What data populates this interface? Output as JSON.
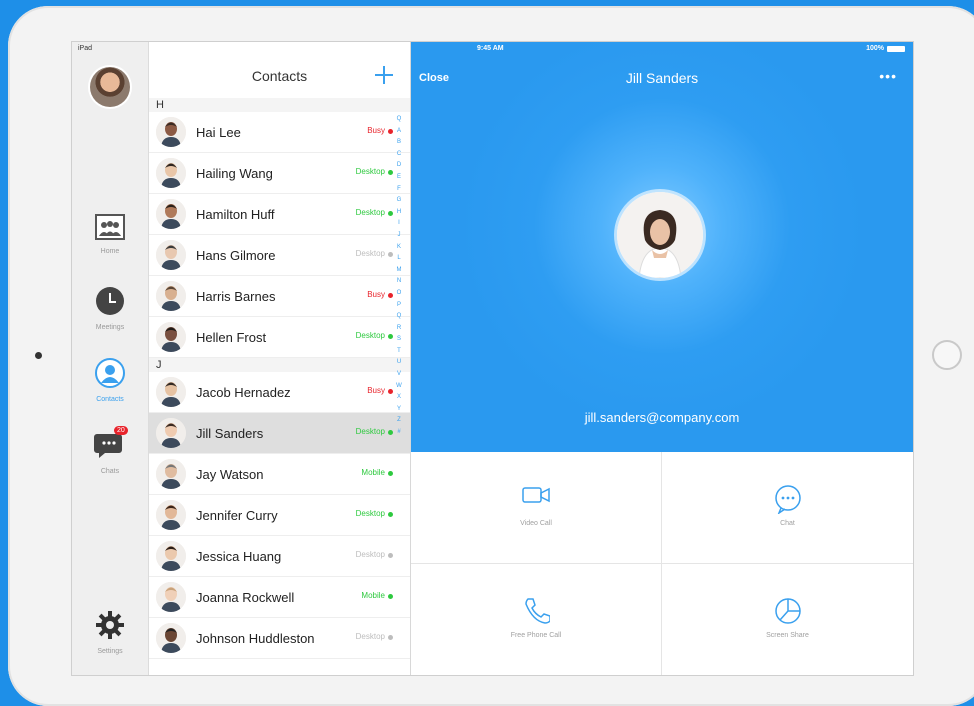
{
  "status_bar": {
    "carrier": "iPad",
    "time": "9:45 AM",
    "battery": "100%"
  },
  "nav": {
    "items": [
      {
        "label": "Home"
      },
      {
        "label": "Meetings"
      },
      {
        "label": "Contacts"
      },
      {
        "label": "Chats",
        "badge": "20"
      },
      {
        "label": "Settings"
      }
    ]
  },
  "contacts": {
    "title": "Contacts",
    "sections": [
      {
        "letter": "H",
        "rows": [
          {
            "name": "Hai Lee",
            "status": "Busy"
          },
          {
            "name": "Hailing Wang",
            "status": "Desktop"
          },
          {
            "name": "Hamilton Huff",
            "status": "Desktop"
          },
          {
            "name": "Hans Gilmore",
            "status": "Desktop"
          },
          {
            "name": "Harris Barnes",
            "status": "Busy"
          },
          {
            "name": "Hellen Frost",
            "status": "Desktop"
          }
        ]
      },
      {
        "letter": "J",
        "rows": [
          {
            "name": "Jacob Hernadez",
            "status": "Busy"
          },
          {
            "name": "Jill Sanders",
            "status": "Desktop"
          },
          {
            "name": "Jay Watson",
            "status": "Mobile"
          },
          {
            "name": "Jennifer Curry",
            "status": "Desktop"
          },
          {
            "name": "Jessica Huang",
            "status": "Desktop"
          },
          {
            "name": "Joanna Rockwell",
            "status": "Mobile"
          },
          {
            "name": "Johnson Huddleston",
            "status": "Desktop"
          }
        ]
      }
    ],
    "index_letters": [
      "Q",
      "A",
      "B",
      "C",
      "D",
      "E",
      "F",
      "G",
      "H",
      "I",
      "J",
      "K",
      "L",
      "M",
      "N",
      "O",
      "P",
      "Q",
      "R",
      "S",
      "T",
      "U",
      "V",
      "W",
      "X",
      "Y",
      "Z",
      "#"
    ]
  },
  "detail": {
    "close_label": "Close",
    "name": "Jill Sanders",
    "more": "•••",
    "email": "jill.sanders@company.com",
    "actions": [
      {
        "label": "Video Call"
      },
      {
        "label": "Chat"
      },
      {
        "label": "Free Phone Call"
      },
      {
        "label": "Screen Share"
      }
    ]
  },
  "colors": {
    "accent": "#2a99ef",
    "busy": "#e8232b",
    "available": "#2ec93f",
    "offline": "#bdbdbd"
  }
}
